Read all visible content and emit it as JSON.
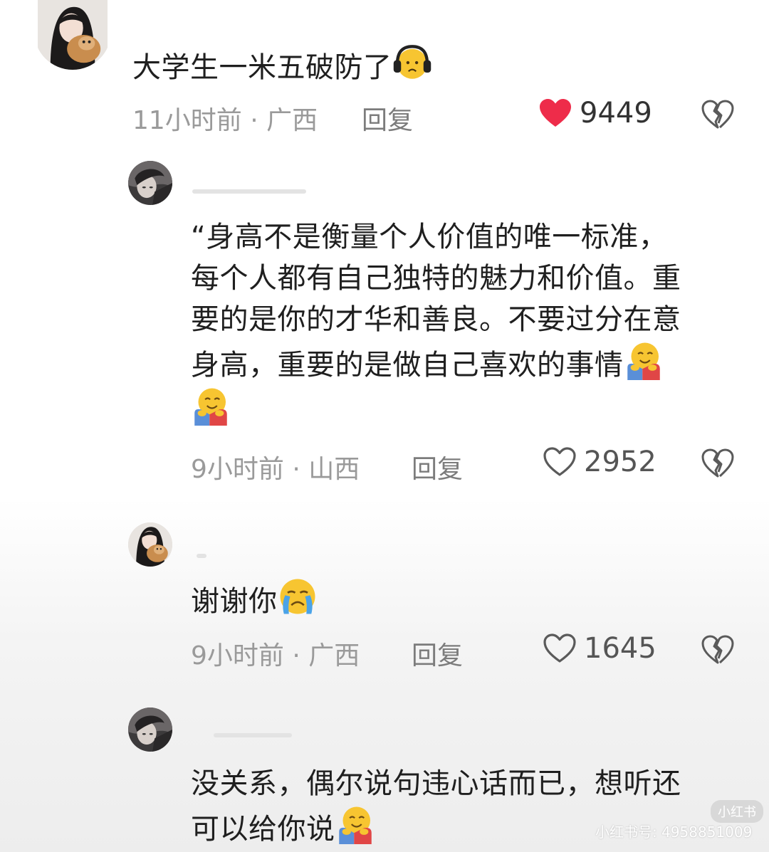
{
  "comments": [
    {
      "text": "大学生一米五破防了",
      "emoji": "headphone-frown-emoji",
      "time": "11小时前",
      "location": "广西",
      "reply_label": "回复",
      "likes": "9449",
      "liked": true,
      "avatar": "girl-with-dog-avatar"
    },
    {
      "text_lines": [
        "“身高不是衡量个人价值的唯一标准，",
        "每个人都有自己独特的魅力和价值。重",
        "要的是你的才华和善良。不要过分在意",
        "身高，重要的是做自己喜欢的事情"
      ],
      "emoji": "hugging-face-emoji",
      "time": "9小时前",
      "location": "山西",
      "reply_label": "回复",
      "likes": "2952",
      "liked": false,
      "avatar": "dark-anime-avatar"
    },
    {
      "text": "谢谢你",
      "emoji": "crying-face-emoji",
      "time": "9小时前",
      "location": "广西",
      "reply_label": "回复",
      "likes": "1645",
      "liked": false,
      "avatar": "girl-with-dog-avatar"
    },
    {
      "text_lines": [
        "没关系，偶尔说句违心话而已，想听还",
        "可以给你说"
      ],
      "emoji": "hugging-face-emoji",
      "avatar": "dark-anime-avatar"
    }
  ],
  "separator": "·",
  "watermark": {
    "logo": "小红书",
    "text": "小红书号: 4958851009"
  },
  "colors": {
    "liked_heart": "#ee2c4a",
    "meta_text": "#9a9a9a",
    "body_text": "#1f1f1f"
  }
}
